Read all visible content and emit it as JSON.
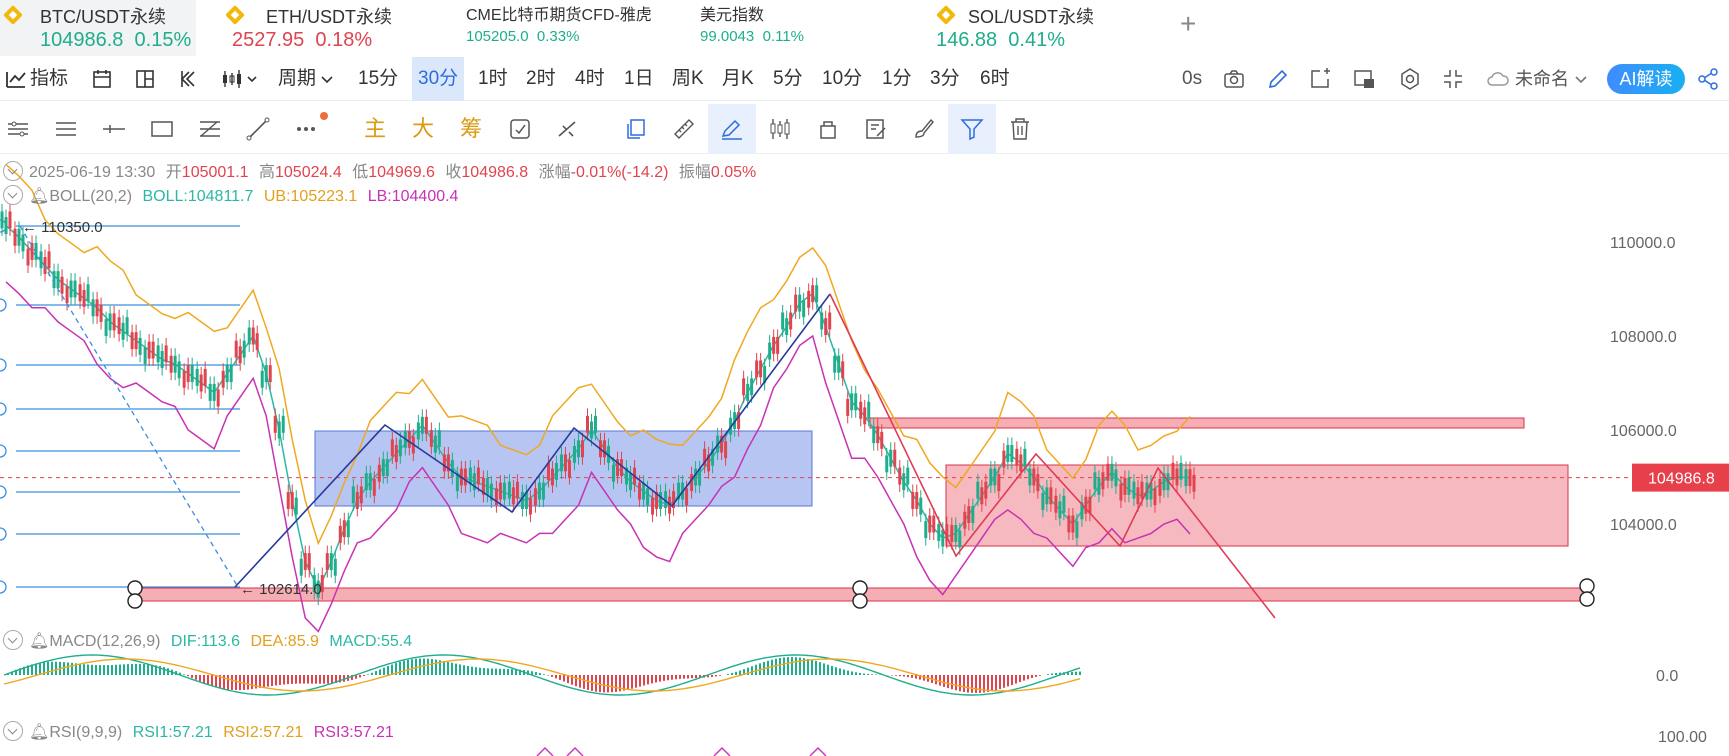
{
  "tickers": [
    {
      "name": "BTC/USDT永续",
      "price": "104986.8",
      "change": "0.15%",
      "trend": "up",
      "icon": "binance-coin-icon"
    },
    {
      "name": "ETH/USDT永续",
      "price": "2527.95",
      "change": "0.18%",
      "trend": "down",
      "icon": "binance-coin-icon"
    },
    {
      "name": "CME比特币期货CFD-雅虎",
      "price": "105205.0",
      "change": "0.33%",
      "trend": "up"
    },
    {
      "name": "美元指数",
      "price": "99.0043",
      "change": "0.11%",
      "trend": "up"
    },
    {
      "name": "SOL/USDT永续",
      "price": "146.88",
      "change": "0.41%",
      "trend": "up",
      "icon": "binance-coin-icon"
    }
  ],
  "add_tab_label": "+",
  "toolbar1": {
    "indicator_label": "指标",
    "period_label": "周期",
    "intervals": [
      "15分",
      "30分",
      "1时",
      "2时",
      "4时",
      "1日",
      "周K",
      "月K",
      "5分",
      "10分",
      "1分",
      "3分",
      "6时"
    ],
    "selected_interval": "30分",
    "countdown": "0s",
    "layout_name": "未命名",
    "ai_label": "AI解读"
  },
  "toolbar2": {
    "labels": [
      "主",
      "大",
      "筹"
    ]
  },
  "ohlc": {
    "date": "2025-06-19 13:30",
    "open_label": "开",
    "open": "105001.1",
    "high_label": "高",
    "high": "105024.4",
    "low_label": "低",
    "low": "104969.6",
    "close_label": "收",
    "close": "104986.8",
    "change_label": "涨幅",
    "change": "-0.01%(-14.2)",
    "amp_label": "振幅",
    "amp": "0.05%"
  },
  "boll": {
    "name": "BOLL(20,2)",
    "mid": "BOLL:104811.7",
    "ub": "UB:105223.1",
    "lb": "LB:104400.4"
  },
  "macd": {
    "name": "MACD(12,26,9)",
    "dif": "DIF:113.6",
    "dea": "DEA:85.9",
    "macd": "MACD:55.4"
  },
  "rsi": {
    "name": "RSI(9,9,9)",
    "rsi1": "RSI1:57.21",
    "rsi2": "RSI2:57.21",
    "rsi3": "RSI3:57.21"
  },
  "price_axis": [
    "110000.0",
    "108000.0",
    "106000.0",
    "104000.0"
  ],
  "current_price": "104986.8",
  "annotations": {
    "high": "110350.0",
    "low": "102614.0"
  },
  "macd_axis": "0.0",
  "rsi_axis": "100.00",
  "colors": {
    "up": "#1fae8c",
    "down": "#e0444e",
    "boll_mid": "#2bb8a4",
    "boll_ub": "#f0a81e",
    "boll_lb": "#c832b4",
    "blue_box": "#7a95e8",
    "red_box": "#f28b96",
    "fib_line": "#3b8fe0",
    "price_tag": "#e8404b"
  },
  "chart_data": {
    "type": "candlestick",
    "price_axis_range": [
      102000,
      111000
    ],
    "close_series": [
      110350,
      110100,
      109800,
      109500,
      109200,
      109000,
      108800,
      108600,
      108300,
      108100,
      107900,
      107700,
      107500,
      107400,
      107200,
      107000,
      106800,
      107200,
      107600,
      108000,
      107200,
      106000,
      104500,
      103200,
      102614,
      103200,
      103900,
      104500,
      104900,
      105200,
      105500,
      105800,
      106100,
      105700,
      105300,
      105000,
      104900,
      104800,
      104700,
      104600,
      104500,
      104700,
      105000,
      105300,
      105600,
      106000,
      105600,
      105200,
      104900,
      104700,
      104500,
      104400,
      104700,
      105000,
      105300,
      105700,
      106200,
      106800,
      107300,
      107800,
      108200,
      108700,
      108900,
      108200,
      107400,
      106600,
      106300,
      105900,
      105400,
      104900,
      104500,
      104000,
      103700,
      103800,
      104200,
      104600,
      105000,
      105500,
      105300,
      105000,
      104600,
      104300,
      104000,
      104400,
      104800,
      105100,
      104800,
      104600,
      104700,
      104900,
      105000,
      104986.8
    ]
  }
}
